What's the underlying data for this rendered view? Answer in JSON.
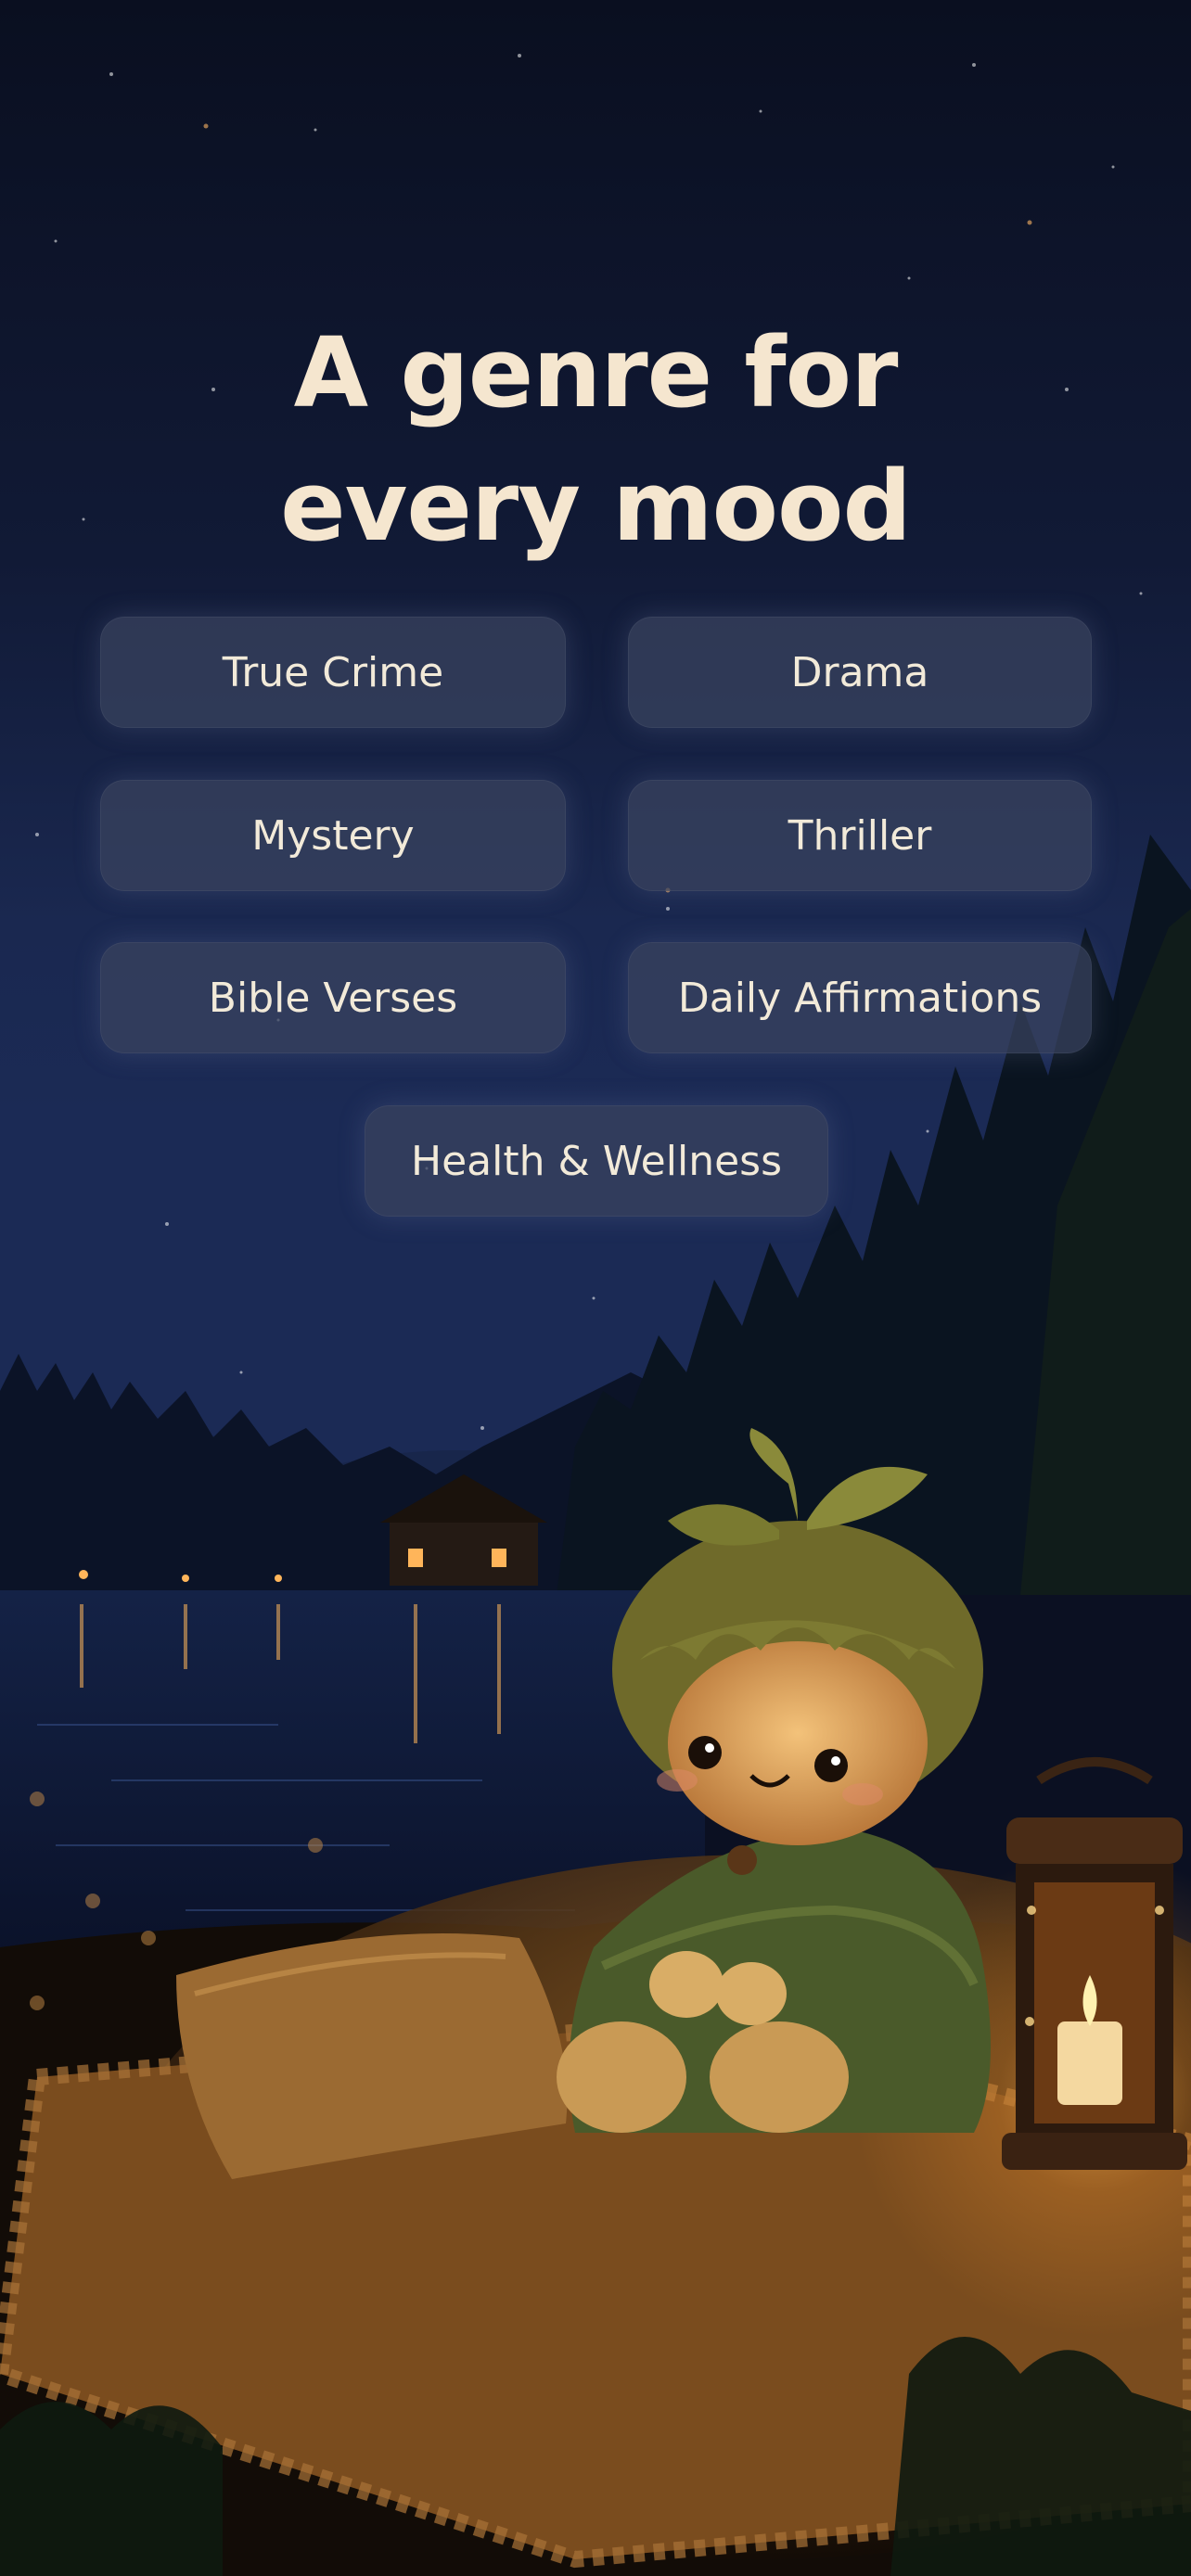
{
  "headline": {
    "line1": "A genre for",
    "line2": "every mood"
  },
  "genres": [
    {
      "label": "True Crime"
    },
    {
      "label": "Drama"
    },
    {
      "label": "Mystery"
    },
    {
      "label": "Thriller"
    },
    {
      "label": "Bible Verses"
    },
    {
      "label": "Daily Affirmations"
    },
    {
      "label": "Health & Wellness"
    }
  ],
  "colors": {
    "sky_top": "#0a0f20",
    "sky_mid": "#17244a",
    "headline": "#f5e6cf",
    "chip_bg": "#3a4460",
    "chip_text": "#f2ead9",
    "candle_glow": "#ffb347"
  },
  "illustration": {
    "description_icon": "knitted-doll-by-lake-at-night"
  }
}
